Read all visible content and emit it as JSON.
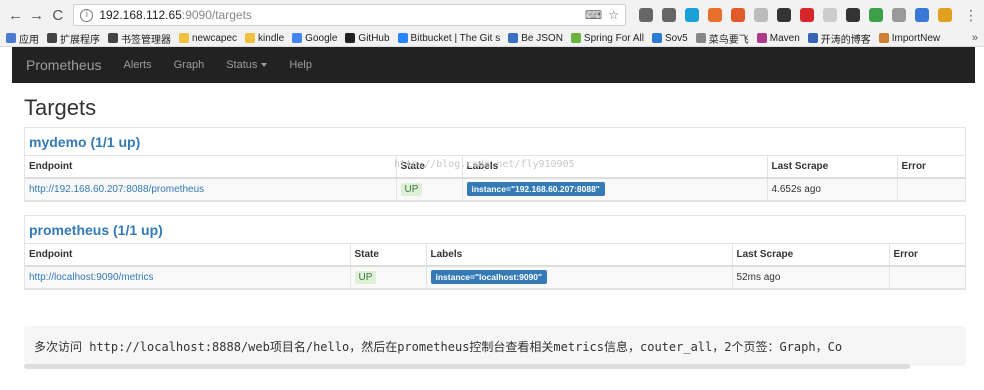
{
  "browser": {
    "url_host": "192.168.112.65",
    "url_path": ":9090/targets",
    "bookmarks": [
      {
        "label": "应用",
        "icon": "apps-icon",
        "color": "#4a7bd0"
      },
      {
        "label": "扩展程序",
        "icon": "puzzle-icon",
        "color": "#444444"
      },
      {
        "label": "书签管理器",
        "icon": "star-icon",
        "color": "#444444"
      },
      {
        "label": "newcapec",
        "icon": "folder-icon",
        "color": "#f0c040"
      },
      {
        "label": "kindle",
        "icon": "folder-icon",
        "color": "#f0c040"
      },
      {
        "label": "Google",
        "icon": "google-icon",
        "color": "#4285f4"
      },
      {
        "label": "GitHub",
        "icon": "github-icon",
        "color": "#222222"
      },
      {
        "label": "Bitbucket | The Git s",
        "icon": "bitbucket-icon",
        "color": "#2684ff"
      },
      {
        "label": "Be JSON",
        "icon": "json-icon",
        "color": "#3a6fc4"
      },
      {
        "label": "Spring For All",
        "icon": "spring-icon",
        "color": "#6db33f"
      },
      {
        "label": "Sov5",
        "icon": "sov5-icon",
        "color": "#2a7ad6"
      },
      {
        "label": "菜鸟要飞",
        "icon": "page-icon",
        "color": "#888888"
      },
      {
        "label": "Maven",
        "icon": "maven-icon",
        "color": "#b03a8a"
      },
      {
        "label": "开涛的博客",
        "icon": "blog-icon",
        "color": "#3466b4"
      },
      {
        "label": "ImportNew",
        "icon": "importnew-icon",
        "color": "#d08030"
      }
    ],
    "more": "»",
    "extensions": [
      {
        "name": "translate-extension-icon",
        "color": "#666666"
      },
      {
        "name": "bookmark-star-icon",
        "color": "#666666"
      },
      {
        "name": "bird-extension-icon",
        "color": "#1aa0d8"
      },
      {
        "name": "orange-x-extension-icon",
        "color": "#e8702a"
      },
      {
        "name": "red-circle-extension-icon",
        "color": "#e25a2a"
      },
      {
        "name": "grey-extension-icon",
        "color": "#bbbbbb"
      },
      {
        "name": "jp-extension-icon",
        "color": "#333333"
      },
      {
        "name": "abp-extension-icon",
        "color": "#d8262a"
      },
      {
        "name": "page-extension-icon",
        "color": "#cccccc"
      },
      {
        "name": "dark-extension-icon",
        "color": "#333333"
      },
      {
        "name": "shield-extension-icon",
        "color": "#3ca04a"
      },
      {
        "name": "grey-box-extension-icon",
        "color": "#999999"
      },
      {
        "name": "blue-w-extension-icon",
        "color": "#3a78d8"
      },
      {
        "name": "chrome-extension-icon",
        "color": "#e0a020"
      }
    ]
  },
  "nav": {
    "brand": "Prometheus",
    "links": [
      "Alerts",
      "Graph",
      "Status",
      "Help"
    ]
  },
  "page": {
    "title": "Targets"
  },
  "jobs": [
    {
      "title": "mydemo (1/1 up)",
      "headers": [
        "Endpoint",
        "State",
        "Labels",
        "Last Scrape",
        "Error"
      ],
      "rows": [
        {
          "endpoint": "http://192.168.60.207:8088/prometheus",
          "state": "UP",
          "label": "instance=\"192.168.60.207:8088\"",
          "last_scrape": "4.652s ago",
          "error": ""
        }
      ]
    },
    {
      "title": "prometheus (1/1 up)",
      "headers": [
        "Endpoint",
        "State",
        "Labels",
        "Last Scrape",
        "Error"
      ],
      "rows": [
        {
          "endpoint": "http://localhost:9090/metrics",
          "state": "UP",
          "label": "instance=\"localhost:9090\"",
          "last_scrape": "52ms ago",
          "error": ""
        }
      ]
    }
  ],
  "watermark": "http://blog.csdn.net/fly910905",
  "code_text": "多次访问 http://localhost:8888/web项目名/hello，然后在prometheus控制台查看相关metrics信息，couter_all，2个页签：Graph，Co"
}
